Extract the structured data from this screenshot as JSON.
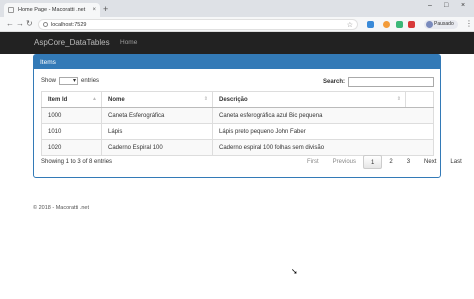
{
  "browser": {
    "tab_title": "Home Page - Macoratti .net",
    "tab_close": "×",
    "new_tab": "+",
    "url": "localhost:7529",
    "paused_label": "Pausado",
    "window_controls": [
      "–",
      "□",
      "×"
    ]
  },
  "app": {
    "brand": "AspCore_DataTables",
    "nav": [
      "Home"
    ]
  },
  "panel": {
    "heading": "Items"
  },
  "length": {
    "show_label": "Show",
    "entries_label": "entries",
    "selected": ""
  },
  "search": {
    "label": "Search:",
    "value": ""
  },
  "table": {
    "columns": [
      "Item Id",
      "Nome",
      "Descrição"
    ],
    "rows": [
      [
        "1000",
        "Caneta Esferográfica",
        "Caneta esferográfica azul Bic pequena"
      ],
      [
        "1010",
        "Lápis",
        "Lápis preto pequeno John Faber"
      ],
      [
        "1020",
        "Caderno Espiral 100",
        "Caderno espiral 100 folhas sem divisão"
      ]
    ]
  },
  "info": "Showing 1 to 3 of 8 entries",
  "pagination": {
    "first": "First",
    "previous": "Previous",
    "pages": [
      "1",
      "2",
      "3"
    ],
    "current": "1",
    "next": "Next",
    "last": "Last"
  },
  "footer": "© 2018 - Macoratti .net"
}
